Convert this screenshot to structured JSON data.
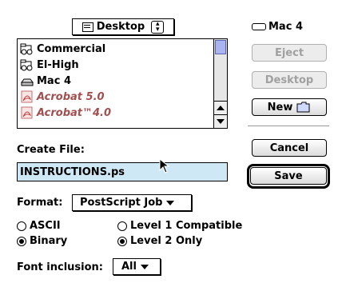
{
  "location_popup": {
    "label": "Desktop"
  },
  "volume": {
    "label": "Mac 4"
  },
  "file_list": {
    "items": [
      {
        "label": "Commercial",
        "icon": "shared-folder-icon",
        "dimmed": false
      },
      {
        "label": "El-High",
        "icon": "shared-folder-icon",
        "dimmed": false
      },
      {
        "label": "Mac 4",
        "icon": "hard-disk-icon",
        "dimmed": false
      },
      {
        "label": "Acrobat 5.0",
        "icon": "acrobat-icon",
        "dimmed": true
      },
      {
        "label": "Acrobat™4.0",
        "icon": "acrobat-icon",
        "dimmed": true
      }
    ]
  },
  "buttons": {
    "eject": "Eject",
    "desktop": "Desktop",
    "new": "New",
    "cancel": "Cancel",
    "save": "Save"
  },
  "create_file": {
    "label": "Create File:",
    "value": "INSTRUCTIONS.ps"
  },
  "format": {
    "label": "Format:",
    "value": "PostScript Job"
  },
  "options": {
    "ascii": "ASCII",
    "binary": "Binary",
    "level1": "Level 1 Compatible",
    "level2": "Level 2 Only",
    "selected_encoding": "Binary",
    "selected_level": "Level 2 Only"
  },
  "font_inclusion": {
    "label": "Font inclusion:",
    "value": "All"
  },
  "colors": {
    "input_highlight": "#cfe8f6",
    "scroll_thumb": "#aab4f0",
    "dim_item": "#a05050"
  }
}
